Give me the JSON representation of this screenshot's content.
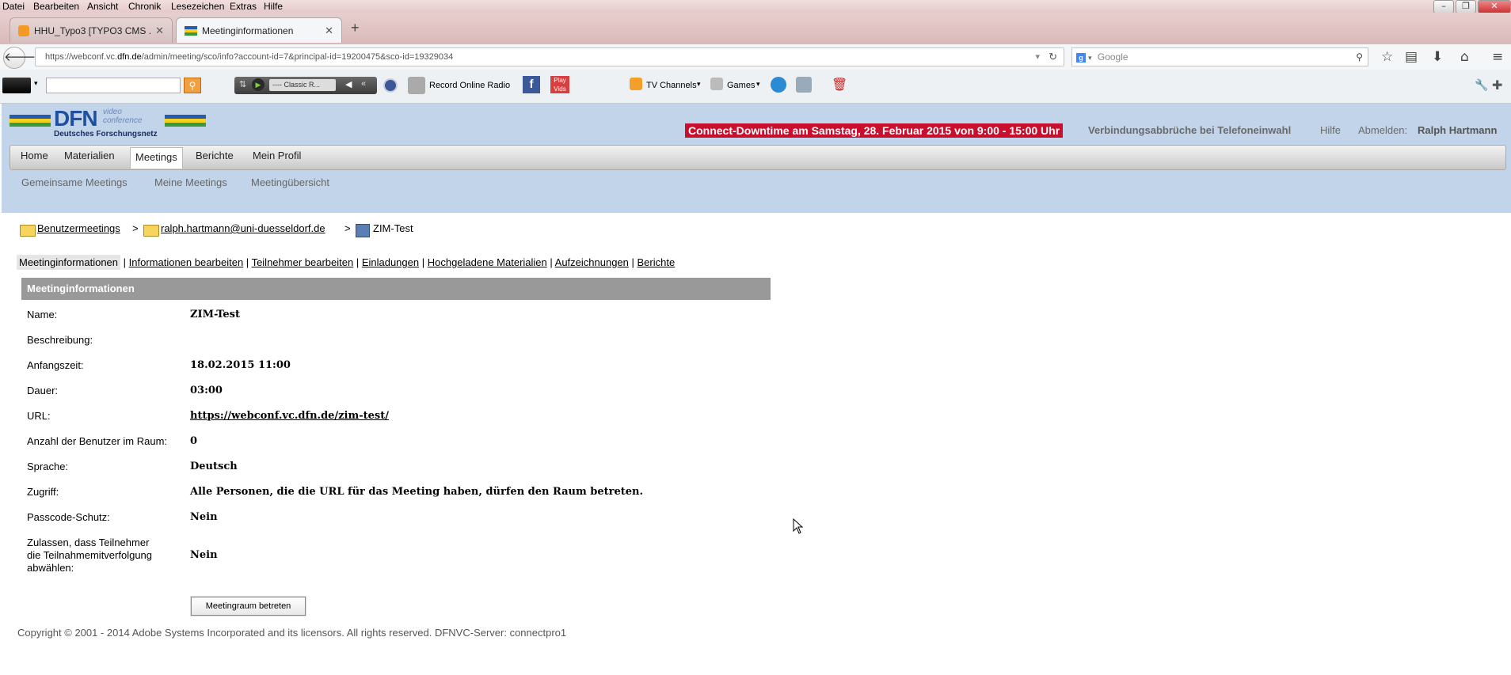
{
  "menubar": {
    "items": [
      "Datei",
      "Bearbeiten",
      "Ansicht",
      "Chronik",
      "Lesezeichen",
      "Extras",
      "Hilfe"
    ]
  },
  "tabs": [
    {
      "title": "HHU_Typo3 [TYPO3 CMS ...",
      "active": false
    },
    {
      "title": "Meetinginformationen",
      "active": true
    }
  ],
  "tab_new": "+",
  "navbar": {
    "url_prefix": "https://webconf.vc.",
    "url_domain": "dfn.de",
    "url_rest": "/admin/meeting/sco/info?account-id=7&principal-id=19200475&sco-id=19329034",
    "search_placeholder": "Google"
  },
  "toolbar": {
    "radio_station": "---- Classic R...",
    "record_radio": "Record Online Radio",
    "tv_channels": "TV Channels",
    "games": "Games",
    "playvids": "Play Vids"
  },
  "header": {
    "logo_main": "DFN",
    "logo_sub1": "video",
    "logo_sub2": "conference",
    "logo_caption": "Deutsches Forschungsnetz",
    "downtime": "Connect-Downtime am Samstag, 28. Februar 2015 von 9:00 - 15:00 Uhr",
    "link_phone": "Verbindungsabbrüche bei Telefoneinwahl",
    "link_help": "Hilfe",
    "logout_label": "Abmelden:",
    "user_name": "Ralph Hartmann"
  },
  "mainnav": [
    "Home",
    "Materialien",
    "Meetings",
    "Berichte",
    "Mein Profil"
  ],
  "subnav": [
    "Gemeinsame Meetings",
    "Meine Meetings",
    "Meetingübersicht"
  ],
  "breadcrumb": {
    "root": "Benutzermeetings",
    "folder": "ralph.hartmann@uni-duesseldorf.de",
    "current": "ZIM-Test",
    "sep": ">"
  },
  "content_tabs": {
    "selected": "Meetinginformationen",
    "links": [
      "Informationen bearbeiten",
      "Teilnehmer bearbeiten",
      "Einladungen",
      "Hochgeladene Materialien",
      "Aufzeichnungen",
      "Berichte"
    ]
  },
  "panel": {
    "title": "Meetinginformationen",
    "rows": [
      {
        "label": "Name:",
        "value": "ZIM-Test"
      },
      {
        "label": "Beschreibung:",
        "value": ""
      },
      {
        "label": "Anfangszeit:",
        "value": "18.02.2015 11:00"
      },
      {
        "label": "Dauer:",
        "value": "03:00"
      },
      {
        "label": "URL:",
        "value": "https://webconf.vc.dfn.de/zim-test/"
      },
      {
        "label": "Anzahl der Benutzer im Raum:",
        "value": "0"
      },
      {
        "label": "Sprache:",
        "value": "Deutsch"
      },
      {
        "label": "Zugriff:",
        "value": "Alle Personen, die die URL für das Meeting haben, dürfen den Raum betreten."
      },
      {
        "label": "Passcode-Schutz:",
        "value": "Nein"
      },
      {
        "label_lines": [
          "Zulassen, dass Teilnehmer",
          "die Teilnahmemitverfolgung",
          "abwählen:"
        ],
        "value": "Nein"
      }
    ],
    "enter_button": "Meetingraum betreten"
  },
  "footer": "Copyright © 2001 - 2014 Adobe Systems Incorporated and its licensors. All rights reserved.  DFNVC-Server: connectpro1",
  "colors": {
    "header_bg": "#c1d4ea",
    "downtime_bg": "#c8102e",
    "panel_head_bg": "#999999"
  }
}
